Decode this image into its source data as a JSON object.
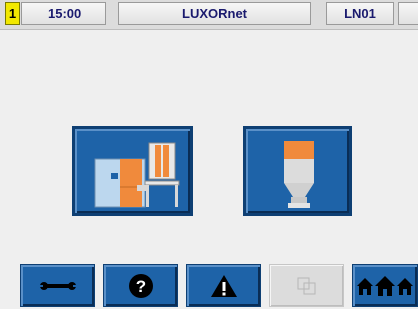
{
  "status_bar": {
    "page_number": "1",
    "time": "15:00",
    "title": "LUXORnet",
    "device_id": "LN01",
    "extra": ""
  },
  "main": {
    "tiles": [
      {
        "icon": "boiler-icon",
        "colors": {
          "tile": "#1e63a8",
          "accent": "#f08a3c"
        }
      },
      {
        "icon": "silo-icon",
        "colors": {
          "tile": "#1e63a8",
          "accent": "#f08a3c"
        }
      }
    ]
  },
  "toolbar": {
    "buttons": [
      {
        "icon": "wrench-icon"
      },
      {
        "icon": "help-icon"
      },
      {
        "icon": "warning-icon"
      },
      {
        "icon": "copy-icon",
        "state": "disabled"
      },
      {
        "icon": "home-icon"
      }
    ]
  },
  "colors": {
    "accent_blue": "#1e63a8",
    "accent_orange": "#f08a3c",
    "highlight_yellow": "#f2e800",
    "header_text": "#1a1a6e"
  }
}
